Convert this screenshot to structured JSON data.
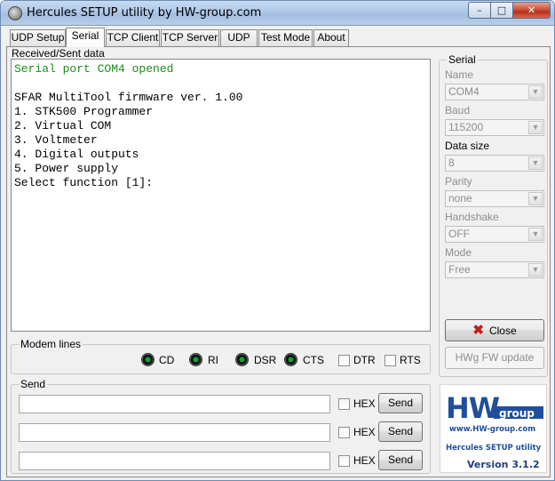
{
  "window": {
    "title": "Hercules SETUP utility by HW-group.com",
    "min": "–",
    "max": "□",
    "close": "✕"
  },
  "tabs": [
    "UDP Setup",
    "Serial",
    "TCP Client",
    "TCP Server",
    "UDP",
    "Test Mode",
    "About"
  ],
  "received": {
    "label": "Received/Sent data",
    "lines": [
      {
        "text": "Serial port COM4 opened",
        "green": true
      },
      {
        "text": "",
        "green": false
      },
      {
        "text": "SFAR MultiTool firmware ver. 1.00",
        "green": false
      },
      {
        "text": "1. STK500 Programmer",
        "green": false
      },
      {
        "text": "2. Virtual COM",
        "green": false
      },
      {
        "text": "3. Voltmeter",
        "green": false
      },
      {
        "text": "4. Digital outputs",
        "green": false
      },
      {
        "text": "5. Power supply",
        "green": false
      },
      {
        "text": "Select function [1]:",
        "green": false
      }
    ]
  },
  "modem": {
    "label": "Modem lines",
    "leds": [
      "CD",
      "RI",
      "DSR",
      "CTS"
    ],
    "checks": [
      "DTR",
      "RTS"
    ]
  },
  "send": {
    "label": "Send",
    "rows": [
      {
        "value": "",
        "hex_label": "HEX",
        "button": "Send"
      },
      {
        "value": "",
        "hex_label": "HEX",
        "button": "Send"
      },
      {
        "value": "",
        "hex_label": "HEX",
        "button": "Send"
      }
    ]
  },
  "serial": {
    "label": "Serial",
    "fields": [
      {
        "label": "Name",
        "value": "COM4",
        "label_enabled": false
      },
      {
        "label": "Baud",
        "value": "115200",
        "label_enabled": false
      },
      {
        "label": "Data size",
        "value": "8",
        "label_enabled": true
      },
      {
        "label": "Parity",
        "value": "none",
        "label_enabled": false
      },
      {
        "label": "Handshake",
        "value": "OFF",
        "label_enabled": false
      },
      {
        "label": "Mode",
        "value": "Free",
        "label_enabled": false
      }
    ],
    "close_button": "Close",
    "fw_button": "HWg FW update"
  },
  "logo": {
    "hw": "HW",
    "group": "group",
    "url": "www.HW-group.com",
    "product": "Hercules SETUP utility",
    "version": "Version  3.1.2"
  },
  "colors": {
    "console_green": "#1d8c1d",
    "logo_blue": "#1f4e9c",
    "close_x_red": "#c0201a"
  }
}
